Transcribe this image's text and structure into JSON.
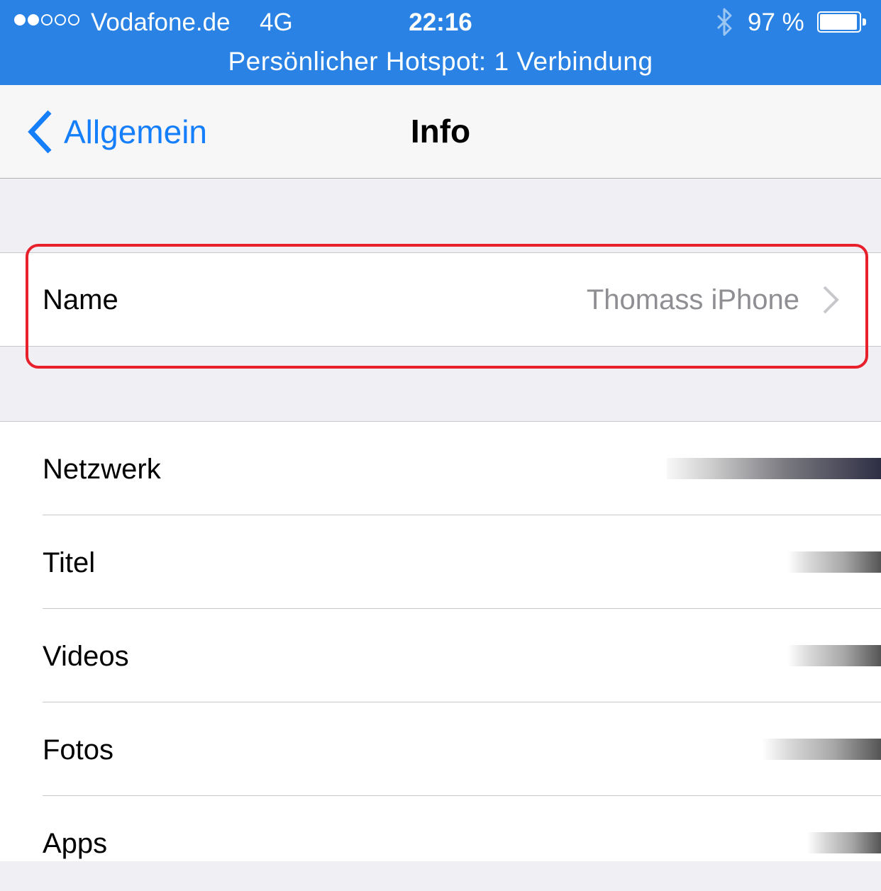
{
  "status_bar": {
    "signal_dots_filled": 2,
    "signal_dots_total": 5,
    "carrier": "Vodafone.de",
    "network": "4G",
    "time": "22:16",
    "battery_percent": "97 %",
    "battery_level": 0.97,
    "hotspot_banner": "Persönlicher Hotspot: 1 Verbindung",
    "background_color": "#2a82e4"
  },
  "nav": {
    "back_label": "Allgemein",
    "title": "Info",
    "accent_color": "#157efb"
  },
  "name_row": {
    "label": "Name",
    "value": "Thomass iPhone"
  },
  "info_rows": [
    {
      "label": "Netzwerk"
    },
    {
      "label": "Titel"
    },
    {
      "label": "Videos"
    },
    {
      "label": "Fotos"
    },
    {
      "label": "Apps"
    }
  ],
  "highlight_color": "#e8202b"
}
